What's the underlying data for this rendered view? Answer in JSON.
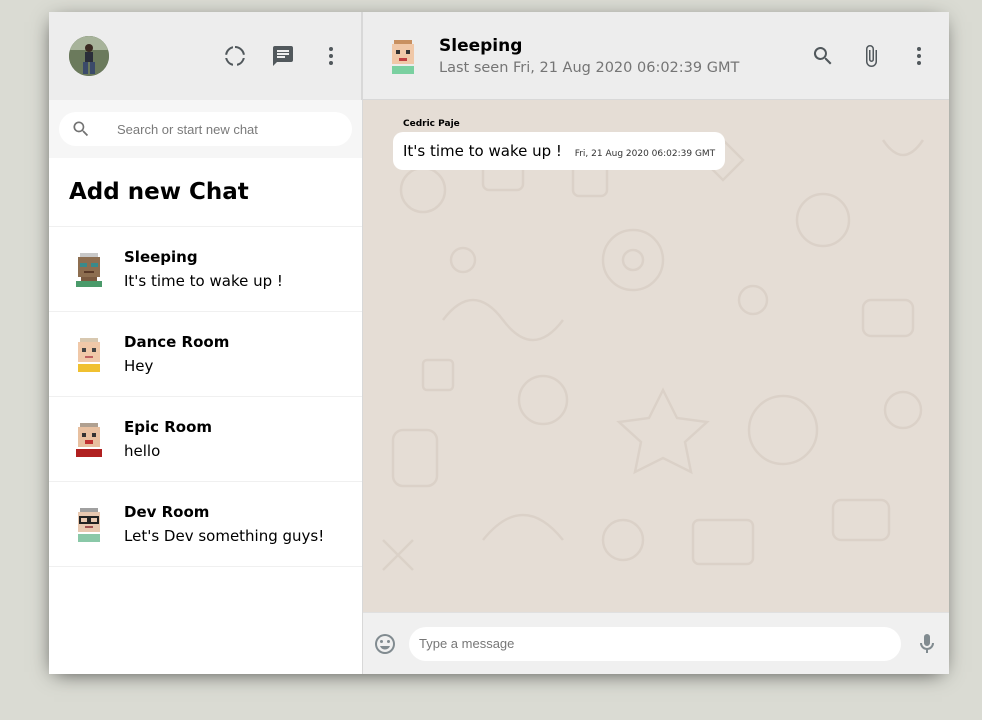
{
  "sidebar": {
    "search": {
      "placeholder": "Search or start new chat"
    },
    "add_chat_label": "Add new Chat",
    "chats": [
      {
        "name": "Sleeping",
        "last_message": "It's time to wake up !",
        "avatar_color": "#8d6e50",
        "accent": "#3a8a6a"
      },
      {
        "name": "Dance Room",
        "last_message": "Hey",
        "avatar_color": "#f0c8a8",
        "accent": "#f0c030"
      },
      {
        "name": "Epic Room",
        "last_message": "hello",
        "avatar_color": "#e8c0a0",
        "accent": "#b02020"
      },
      {
        "name": "Dev Room",
        "last_message": "Let's Dev something guys!",
        "avatar_color": "#e8c8b0",
        "accent": "#8ac8a8"
      }
    ]
  },
  "chat": {
    "title": "Sleeping",
    "last_seen": "Last seen Fri, 21 Aug 2020 06:02:39 GMT",
    "messages": [
      {
        "sender": "Cedric Paje",
        "text": "It's time to wake up !",
        "time": "Fri, 21 Aug 2020 06:02:39 GMT"
      }
    ],
    "input_placeholder": "Type a message"
  },
  "colors": {
    "page_bg": "#dadbd3",
    "header_bg": "#ededed",
    "chat_bg": "#e5ddd5",
    "icon": "#51585c"
  }
}
